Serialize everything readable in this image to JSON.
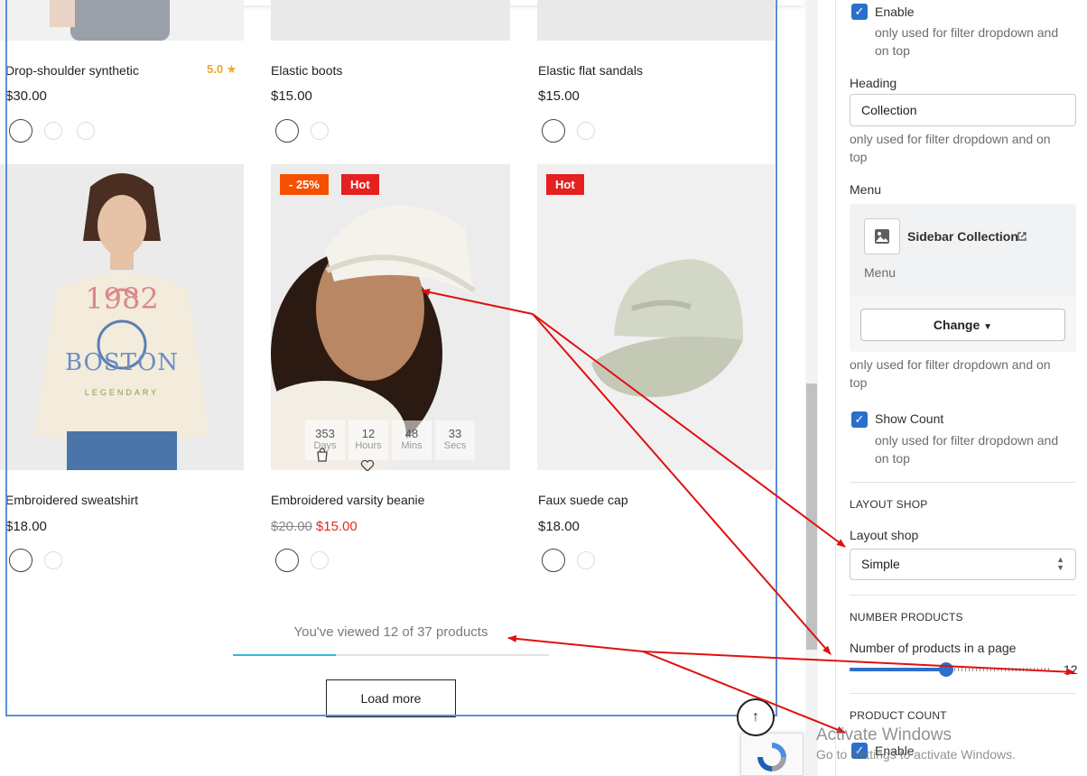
{
  "products": [
    {
      "name": "Drop-shoulder synthetic",
      "price": "$30.00",
      "rating": "5.0 ★"
    },
    {
      "name": "Elastic boots",
      "price": "$15.00"
    },
    {
      "name": "Elastic flat sandals",
      "price": "$15.00"
    },
    {
      "name": "Embroidered sweatshirt",
      "price": "$18.00",
      "print_top": "1982",
      "print_main": "BOSTON",
      "print_sub": "LEGENDARY"
    },
    {
      "name": "Embroidered varsity beanie",
      "old_price": "$20.00",
      "price": "$15.00",
      "badges": [
        "- 25%",
        "Hot"
      ],
      "countdown": [
        {
          "value": "353",
          "label": "Days"
        },
        {
          "value": "12",
          "label": "Hours"
        },
        {
          "value": "48",
          "label": "Mins"
        },
        {
          "value": "33",
          "label": "Secs"
        }
      ]
    },
    {
      "name": "Faux suede cap",
      "price": "$18.00",
      "badges": [
        "Hot"
      ]
    }
  ],
  "pagination": {
    "viewed_text": "You've viewed 12 of 37 products",
    "viewed": 12,
    "total": 37,
    "load_more": "Load more"
  },
  "back_to_top_icon": "arrow-up-icon",
  "settings": {
    "enable_top": {
      "label": "Enable",
      "help": "only used for filter dropdown and on top",
      "checked": true
    },
    "heading": {
      "label": "Heading",
      "value": "Collection",
      "help": "only used for filter dropdown and on top"
    },
    "menu": {
      "label": "Menu",
      "name": "Sidebar Collection",
      "caption": "Menu",
      "change": "Change",
      "help": "only used for filter dropdown and on top"
    },
    "show_count": {
      "label": "Show Count",
      "help": "only used for filter dropdown and on top",
      "checked": true
    },
    "layout_shop": {
      "section": "LAYOUT SHOP",
      "label": "Layout shop",
      "value": "Simple"
    },
    "number_products": {
      "section": "NUMBER PRODUCTS",
      "label": "Number of products in a page",
      "value": "12"
    },
    "product_count": {
      "section": "PRODUCT COUNT",
      "label": "Enable",
      "checked": true
    }
  },
  "watermark": {
    "title": "Activate Windows",
    "subtitle": "Go to Settings to activate Windows."
  },
  "colors": {
    "accent": "#2c6ecb",
    "sale_badge": "#f45000",
    "hot_badge": "#e62020",
    "progress": "#38b6e6",
    "annotation": "#e01010"
  }
}
